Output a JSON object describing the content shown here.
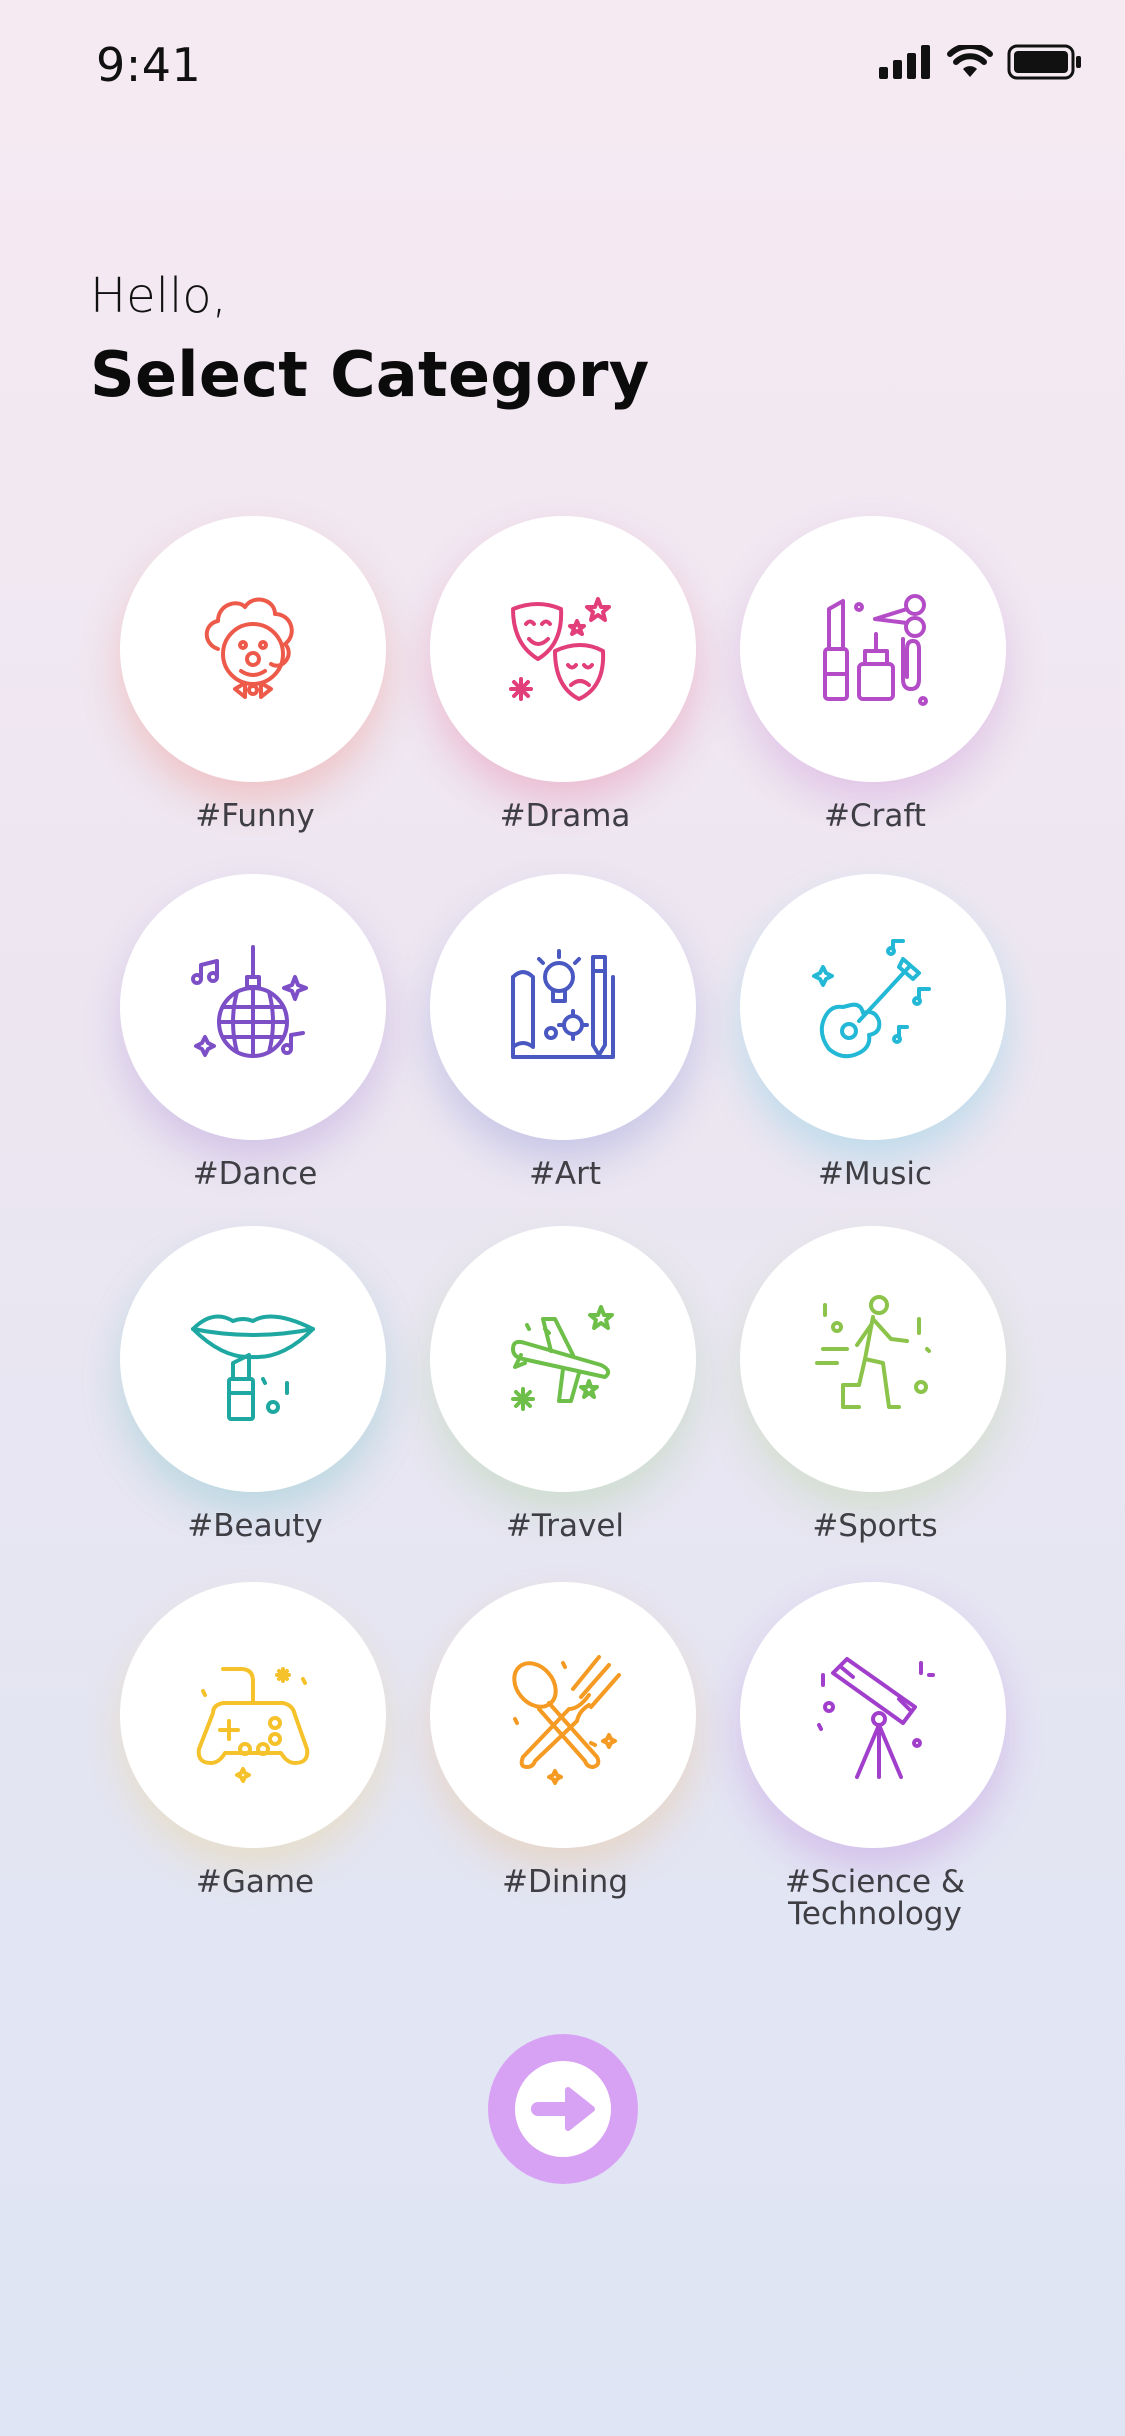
{
  "status_bar": {
    "time": "9:41",
    "icons": [
      "cellular-signal-icon",
      "wifi-icon",
      "battery-icon"
    ]
  },
  "header": {
    "greeting": "Hello,",
    "title": "Select Category"
  },
  "categories": [
    {
      "label": "#Funny",
      "icon": "clown-icon",
      "color": "#ee5a4a"
    },
    {
      "label": "#Drama",
      "icon": "theater-masks-icon",
      "color": "#e23e79"
    },
    {
      "label": "#Craft",
      "icon": "craft-tools-icon",
      "color": "#b34cc6"
    },
    {
      "label": "#Dance",
      "icon": "disco-ball-icon",
      "color": "#7c4fc6"
    },
    {
      "label": "#Art",
      "icon": "art-design-icon",
      "color": "#4a58c2"
    },
    {
      "label": "#Music",
      "icon": "guitar-icon",
      "color": "#22b8d6"
    },
    {
      "label": "#Beauty",
      "icon": "lipstick-icon",
      "color": "#1fa8a2"
    },
    {
      "label": "#Travel",
      "icon": "airplane-icon",
      "color": "#6dbf4a"
    },
    {
      "label": "#Sports",
      "icon": "runner-icon",
      "color": "#8cc34a"
    },
    {
      "label": "#Game",
      "icon": "gamepad-icon",
      "color": "#f5c22b"
    },
    {
      "label": "#Dining",
      "icon": "spoon-fork-icon",
      "color": "#f59a22"
    },
    {
      "label": "#Science &\nTechnology",
      "icon": "telescope-icon",
      "color": "#a13fcc"
    }
  ],
  "next_button": {
    "icon": "arrow-right-circle-icon",
    "color": "#d8a2f4"
  }
}
